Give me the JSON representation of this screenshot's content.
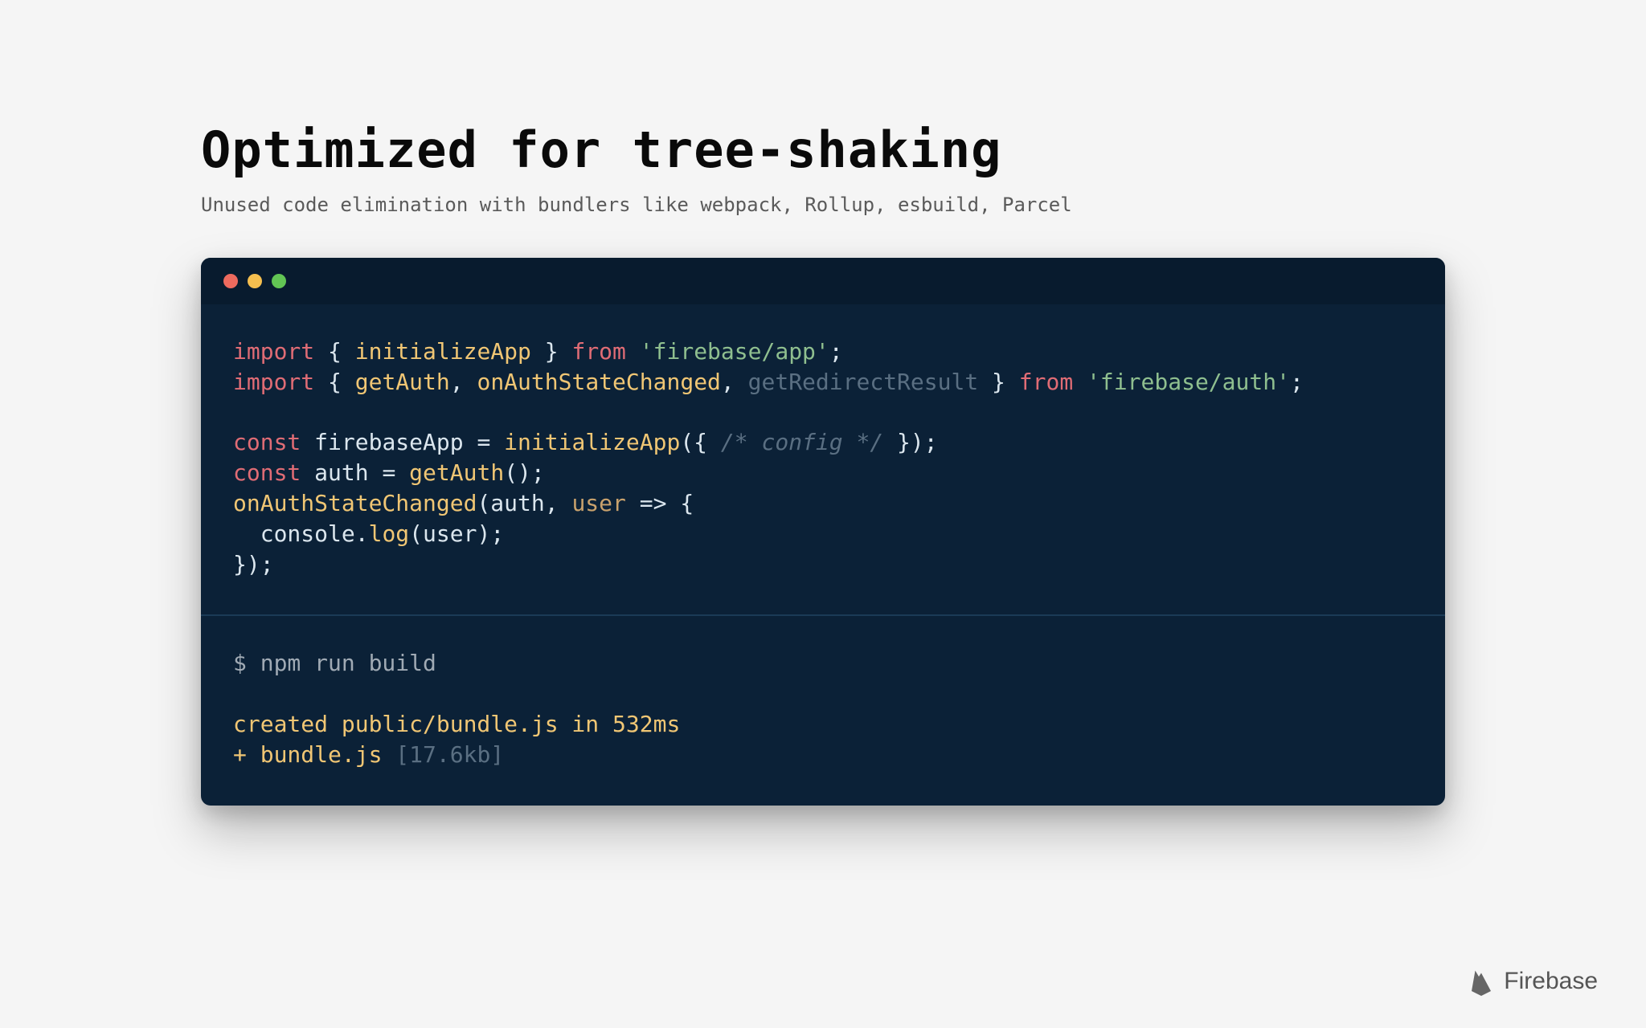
{
  "title": "Optimized for tree-shaking",
  "subtitle": "Unused code elimination with bundlers like webpack, Rollup, esbuild, Parcel",
  "code": {
    "line1": {
      "kw": "import",
      "open": " { ",
      "fn": "initializeApp",
      "close": " } ",
      "from": "from",
      "sp": " ",
      "str": "'firebase/app'",
      "semi": ";"
    },
    "line2": {
      "kw": "import",
      "open": " { ",
      "fn1": "getAuth",
      "c1": ", ",
      "fn2": "onAuthStateChanged",
      "c2": ", ",
      "unused": "getRedirectResult",
      "close": " } ",
      "from": "from",
      "sp": " ",
      "str": "'firebase/auth'",
      "semi": ";"
    },
    "blank1": "",
    "line3": {
      "kw": "const",
      "sp1": " ",
      "id": "firebaseApp",
      "eq": " = ",
      "fn": "initializeApp",
      "open": "({ ",
      "comment": "/* config */",
      "close": " });"
    },
    "line4": {
      "kw": "const",
      "sp1": " ",
      "id": "auth",
      "eq": " = ",
      "fn": "getAuth",
      "call": "();"
    },
    "line5": {
      "fn": "onAuthStateChanged",
      "open": "(",
      "arg1": "auth",
      "c": ", ",
      "param": "user",
      "arrow": " => {"
    },
    "line6": {
      "indent": "  ",
      "obj": "console",
      "dot": ".",
      "method": "log",
      "open": "(",
      "arg": "user",
      "close": ");"
    },
    "line7": {
      "close": "});"
    }
  },
  "term": {
    "prompt": "$ npm run build",
    "blank": "",
    "out1": "created public/bundle.js in 532ms",
    "out2a": "+ bundle.js ",
    "out2b": "[17.6kb]"
  },
  "brand": "Firebase"
}
